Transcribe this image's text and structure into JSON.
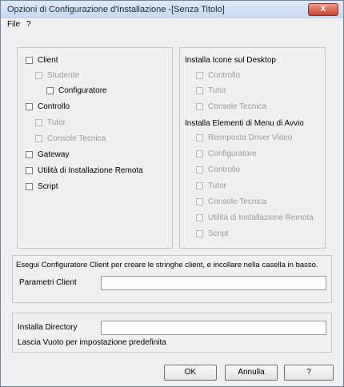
{
  "window": {
    "title": "Opzioni di Configurazione d'Installazione -[Senza Titolo]",
    "close_glyph": "X"
  },
  "menu": {
    "file": "File",
    "help": "?"
  },
  "components": {
    "client": "Client",
    "studente": "Studente",
    "configuratore": "Configuratore",
    "controllo": "Controllo",
    "tutor": "Tutor",
    "console_tecnica": "Console Tecnica",
    "gateway": "Gateway",
    "utilita": "Utilità di Installazione Remota",
    "script": "Script"
  },
  "desktop_icons": {
    "heading": "Installa Icone sul Desktop",
    "controllo": "Controllo",
    "tutor": "Tutor",
    "console_tecnica": "Console Tecnica"
  },
  "start_menu": {
    "heading": "Installa Elementi di Menu di Avvio",
    "reimposta": "Reimposta Driver Video",
    "configuratore": "Configuratore",
    "controllo": "Controllo",
    "tutor": "Tutor",
    "console_tecnica": "Console Tecnica",
    "utilita": "Utilità di Installazione Remota",
    "script": "Script"
  },
  "client_params": {
    "instruction": "Esegui Configuratore Client per creare le stringhe client, e incollare nella casella in basso.",
    "label": "Parametri Client",
    "value": ""
  },
  "install_dir": {
    "label": "Installa Directory",
    "value": "",
    "hint": "Lascia Vuoto per impostazione predefinita"
  },
  "buttons": {
    "ok": "OK",
    "annulla": "Annulla",
    "help": "?"
  }
}
